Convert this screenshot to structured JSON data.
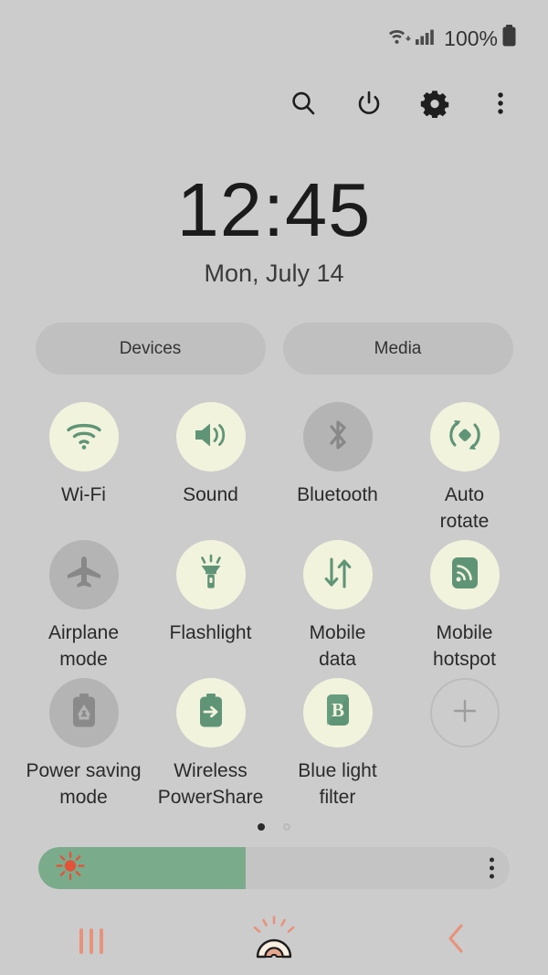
{
  "statusbar": {
    "wifi_icon": "wifi-data-icon",
    "signal_icon": "cellular-signal-icon",
    "battery_percent": "100%",
    "battery_icon": "battery-full-icon"
  },
  "toolbar": {
    "buttons": [
      {
        "name": "search-icon",
        "label": "Search"
      },
      {
        "name": "power-icon",
        "label": "Power"
      },
      {
        "name": "settings-gear-icon",
        "label": "Settings"
      },
      {
        "name": "more-options-icon",
        "label": "More options"
      }
    ]
  },
  "clock": {
    "time": "12:45",
    "date": "Mon, July 14"
  },
  "pills": [
    {
      "label": "Devices"
    },
    {
      "label": "Media"
    }
  ],
  "tiles": [
    {
      "label": "Wi-Fi",
      "icon": "wifi-icon",
      "state": "on"
    },
    {
      "label": "Sound",
      "icon": "sound-icon",
      "state": "on"
    },
    {
      "label": "Bluetooth",
      "icon": "bluetooth-icon",
      "state": "off"
    },
    {
      "label": "Auto\nrotate",
      "icon": "auto-rotate-icon",
      "state": "on"
    },
    {
      "label": "Airplane\nmode",
      "icon": "airplane-icon",
      "state": "off"
    },
    {
      "label": "Flashlight",
      "icon": "flashlight-icon",
      "state": "on"
    },
    {
      "label": "Mobile\ndata",
      "icon": "mobile-data-icon",
      "state": "on"
    },
    {
      "label": "Mobile\nhotspot",
      "icon": "mobile-hotspot-icon",
      "state": "on"
    },
    {
      "label": "Power saving\nmode",
      "icon": "power-saving-icon",
      "state": "off"
    },
    {
      "label": "Wireless\nPowerShare",
      "icon": "power-share-icon",
      "state": "on"
    },
    {
      "label": "Blue light\nfilter",
      "icon": "blue-light-filter-icon",
      "state": "on"
    },
    {
      "label": "",
      "icon": "add-button-icon",
      "state": "add"
    }
  ],
  "pager": {
    "total": 2,
    "active_index": 0
  },
  "brightness": {
    "value_percent": 44,
    "sun_icon": "brightness-sun-icon",
    "menu_icon": "brightness-more-options-icon"
  },
  "navbar": [
    {
      "name": "recents-button",
      "label": "Recents"
    },
    {
      "name": "home-button",
      "label": "Home"
    },
    {
      "name": "back-button",
      "label": "Back"
    }
  ],
  "colors": {
    "background": "#cccccc",
    "tile_on_bg": "#f2f3dd",
    "tile_off_bg": "#b4b4b4",
    "icon_green": "#5f9476",
    "slider_fill": "#7aab8b",
    "sun_orange": "#e2533a",
    "nav_coral": "#e8927c"
  }
}
